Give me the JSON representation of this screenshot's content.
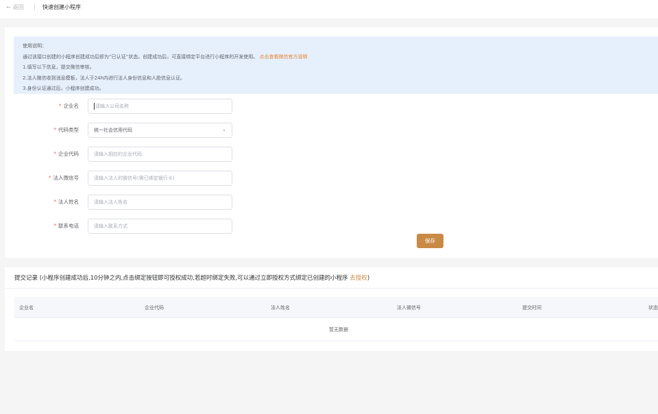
{
  "header": {
    "back_label": "返回",
    "title": "快速创建小程序"
  },
  "notice": {
    "heading": "使用说明：",
    "line1": "通过该接口创建的小程序创建成功后即为“已认证”状态。创建成功后，可直接绑定平台进行小程序的开发使用。",
    "line1_link": "点击查看微信官方说明",
    "step1": "1.填写以下信息，提交微信审核。",
    "step2": "2.法人微信收到消息模板，法人于24h内进行法人身份信息和人脸信息认证。",
    "step3": "3.身份认证通过后，小程序创建成功。"
  },
  "form": {
    "fields": [
      {
        "label": "企业名",
        "placeholder": "请输入公司名称"
      },
      {
        "label": "代码类型",
        "value": "统一社会信用代码"
      },
      {
        "label": "企业代码",
        "placeholder": "请输入相应的企业代码"
      },
      {
        "label": "法人微信号",
        "placeholder": "请输入法人的微信号(需已绑定银行卡)"
      },
      {
        "label": "法人姓名",
        "placeholder": "请输入法人姓名"
      },
      {
        "label": "联系电话",
        "placeholder": "请输入联系方式"
      }
    ],
    "save_label": "保存"
  },
  "records": {
    "title": "提交记录 (小程序创建成功后,10分钟之内,点击绑定按钮即可授权成功,若超时绑定失败,可以通过立即授权方式绑定已创建的小程序",
    "link": "去授权",
    "title_suffix": ")",
    "columns": [
      "企业名",
      "企业代码",
      "法人姓名",
      "法人微信号",
      "提交时间",
      "状态"
    ],
    "empty_text": "暂无数据"
  },
  "colors": {
    "accent": "#c98a45",
    "link": "#e6812d",
    "required": "#f56c6c",
    "notice_bg": "#e6f0fd"
  }
}
